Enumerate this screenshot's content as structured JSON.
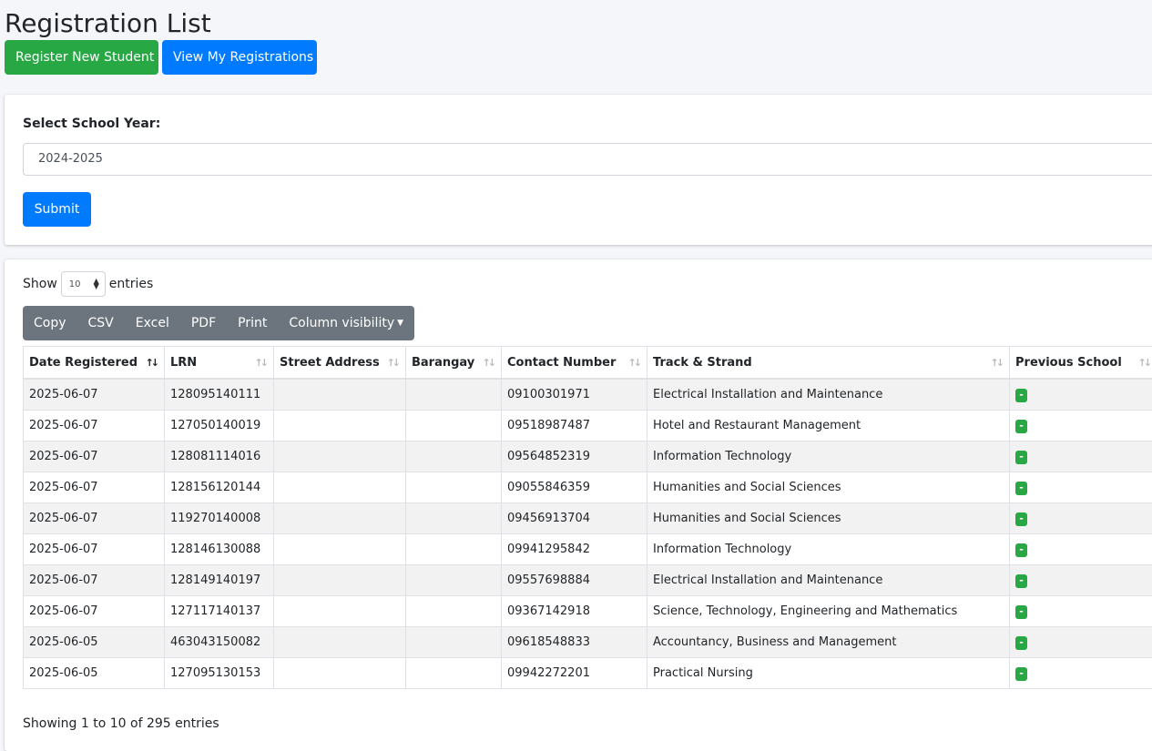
{
  "page": {
    "title": "Registration List",
    "register_btn": "Register New Student",
    "view_btn": "View My Registrations"
  },
  "filter": {
    "label": "Select School Year:",
    "selected": "2024-2025",
    "submit": "Submit"
  },
  "table_controls": {
    "show": "Show",
    "length": "10",
    "entries": "entries",
    "buttons": [
      "Copy",
      "CSV",
      "Excel",
      "PDF",
      "Print",
      "Column visibility"
    ]
  },
  "table": {
    "columns": [
      "Date Registered",
      "LRN",
      "Street Address",
      "Barangay",
      "Contact Number",
      "Track & Strand",
      "Previous School"
    ],
    "rows": [
      {
        "date": "2025-06-07",
        "lrn": "128095140111",
        "street": "",
        "barangay": "",
        "contact": "09100301971",
        "track": "Electrical Installation and Maintenance",
        "prev": "-"
      },
      {
        "date": "2025-06-07",
        "lrn": "127050140019",
        "street": "",
        "barangay": "",
        "contact": "09518987487",
        "track": "Hotel and Restaurant Management",
        "prev": "-"
      },
      {
        "date": "2025-06-07",
        "lrn": "128081114016",
        "street": "",
        "barangay": "",
        "contact": "09564852319",
        "track": "Information Technology",
        "prev": "-"
      },
      {
        "date": "2025-06-07",
        "lrn": "128156120144",
        "street": "",
        "barangay": "",
        "contact": "09055846359",
        "track": "Humanities and Social Sciences",
        "prev": "-"
      },
      {
        "date": "2025-06-07",
        "lrn": "119270140008",
        "street": "",
        "barangay": "",
        "contact": "09456913704",
        "track": "Humanities and Social Sciences",
        "prev": "-"
      },
      {
        "date": "2025-06-07",
        "lrn": "128146130088",
        "street": "",
        "barangay": "",
        "contact": "09941295842",
        "track": "Information Technology",
        "prev": "-"
      },
      {
        "date": "2025-06-07",
        "lrn": "128149140197",
        "street": "",
        "barangay": "",
        "contact": "09557698884",
        "track": "Electrical Installation and Maintenance",
        "prev": "-"
      },
      {
        "date": "2025-06-07",
        "lrn": "127117140137",
        "street": "",
        "barangay": "",
        "contact": "09367142918",
        "track": "Science, Technology, Engineering and Mathematics",
        "prev": "-"
      },
      {
        "date": "2025-06-05",
        "lrn": "463043150082",
        "street": "",
        "barangay": "",
        "contact": "09618548833",
        "track": "Accountancy, Business and Management",
        "prev": "-"
      },
      {
        "date": "2025-06-05",
        "lrn": "127095130153",
        "street": "",
        "barangay": "",
        "contact": "09942272201",
        "track": "Practical Nursing",
        "prev": "-"
      }
    ]
  },
  "info": "Showing 1 to 10 of 295 entries",
  "colors": {
    "green": "#28a745",
    "blue": "#007bff",
    "gray": "#6c757d"
  }
}
